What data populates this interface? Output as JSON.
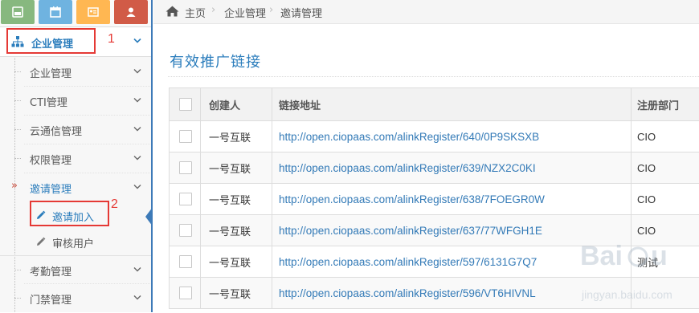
{
  "sidebar": {
    "shortcuts": [
      {
        "icon": "signal-icon",
        "color": "#87b87f"
      },
      {
        "icon": "calendar-icon",
        "color": "#6fb3e0"
      },
      {
        "icon": "id-card-icon",
        "color": "#ffb752"
      },
      {
        "icon": "users-icon",
        "color": "#d15b47"
      }
    ],
    "top_menu": {
      "label": "企业管理",
      "icon": "sitemap-icon"
    },
    "items": [
      {
        "label": "企业管理"
      },
      {
        "label": "CTI管理"
      },
      {
        "label": "云通信管理"
      },
      {
        "label": "权限管理"
      },
      {
        "label": "邀请管理",
        "arrow": "»"
      },
      {
        "label": "考勤管理"
      },
      {
        "label": "门禁管理"
      }
    ],
    "sub_items": [
      {
        "label": "邀请加入"
      },
      {
        "label": "审核用户"
      }
    ]
  },
  "annotations": [
    "1",
    "2"
  ],
  "breadcrumb": {
    "home": "主页",
    "level1": "企业管理",
    "level2": "邀请管理",
    "separator": "›"
  },
  "page": {
    "title": "有效推广链接"
  },
  "table": {
    "headers": [
      "创建人",
      "链接地址",
      "注册部门"
    ],
    "rows": [
      {
        "creator": "一号互联",
        "link": "http://open.ciopaas.com/alinkRegister/640/0P9SKSXB",
        "dept": "CIO"
      },
      {
        "creator": "一号互联",
        "link": "http://open.ciopaas.com/alinkRegister/639/NZX2C0KI",
        "dept": "CIO"
      },
      {
        "creator": "一号互联",
        "link": "http://open.ciopaas.com/alinkRegister/638/7FOEGR0W",
        "dept": "CIO"
      },
      {
        "creator": "一号互联",
        "link": "http://open.ciopaas.com/alinkRegister/637/77WFGH1E",
        "dept": "CIO"
      },
      {
        "creator": "一号互联",
        "link": "http://open.ciopaas.com/alinkRegister/597/6131G7Q7",
        "dept": "测试"
      },
      {
        "creator": "一号互联",
        "link": "http://open.ciopaas.com/alinkRegister/596/VT6HIVNL",
        "dept": ""
      }
    ]
  },
  "watermark": {
    "text": "Baidu 经验",
    "subtext": "jingyan.baidu.com"
  }
}
